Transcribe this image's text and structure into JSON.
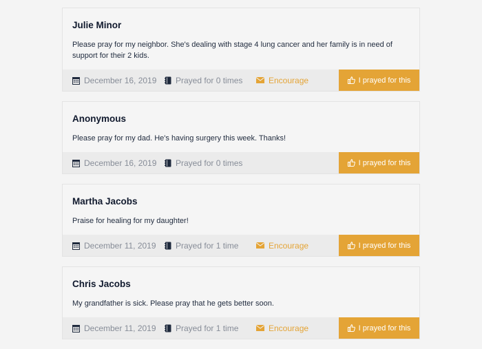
{
  "requests": [
    {
      "name": "Julie Minor",
      "text": "Please pray for my neighbor. She's dealing with stage 4 lung cancer and her family is in need of support for their 2 kids.",
      "date": "December 16, 2019",
      "prayed": "Prayed for 0 times",
      "encourage": "Encourage",
      "button": "I prayed for this"
    },
    {
      "name": "Anonymous",
      "text": "Please pray for my dad. He's having surgery this week. Thanks!",
      "date": "December 16, 2019",
      "prayed": "Prayed for 0 times",
      "encourage": "",
      "button": "I prayed for this"
    },
    {
      "name": "Martha Jacobs",
      "text": "Praise for healing for my daughter!",
      "date": "December 11, 2019",
      "prayed": "Prayed for 1 time",
      "encourage": "Encourage",
      "button": "I prayed for this"
    },
    {
      "name": "Chris Jacobs",
      "text": "My grandfather is sick. Please pray that he gets better soon.",
      "date": "December 11, 2019",
      "prayed": "Prayed for 1 time",
      "encourage": "Encourage",
      "button": "I prayed for this"
    }
  ],
  "colors": {
    "accent": "#e4a436",
    "name": "#111a2e",
    "meta": "#878d98",
    "footer_bg": "#ebebeb",
    "icon": "#1f2a3d"
  },
  "icons": {
    "date": "calendar-icon",
    "prayed": "book-icon",
    "encourage": "envelope-icon",
    "button": "thumbs-up-icon"
  }
}
